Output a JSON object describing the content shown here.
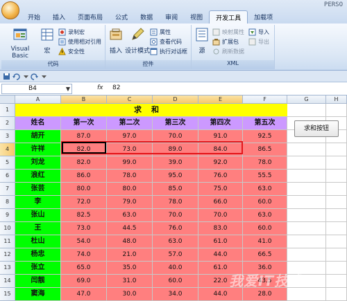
{
  "window": {
    "title_right": "PERSO"
  },
  "ribbon": {
    "tabs": [
      "开始",
      "插入",
      "页面布局",
      "公式",
      "数据",
      "审阅",
      "视图",
      "开发工具",
      "加载项"
    ],
    "active_tab": "开发工具",
    "groups": {
      "code": {
        "label": "代码",
        "visual_basic": "Visual Basic",
        "macros": "宏",
        "record_macro": "录制宏",
        "relative_refs": "使用相对引用",
        "macro_security": "安全性"
      },
      "controls": {
        "label": "控件",
        "insert": "插入",
        "design_mode": "设计模式",
        "properties": "属性",
        "view_code": "查看代码",
        "run_dialog": "执行对话框"
      },
      "xml": {
        "label": "XML",
        "source": "源",
        "map_properties": "映射属性",
        "expansion_packs": "扩展包",
        "refresh_data": "刷新数据",
        "import": "导入",
        "export": "导出"
      }
    }
  },
  "formula_bar": {
    "name_box": "B4",
    "fx": "fx",
    "value": "82"
  },
  "sheet": {
    "columns": [
      "A",
      "B",
      "C",
      "D",
      "E",
      "F",
      "G",
      "H"
    ],
    "rows": [
      "1",
      "2",
      "3",
      "4",
      "5",
      "6",
      "7",
      "8",
      "9",
      "10",
      "11",
      "12",
      "13",
      "14",
      "15",
      "16"
    ],
    "title": "求和",
    "headers": [
      "姓名",
      "第一次",
      "第二次",
      "第三次",
      "第四次",
      "第五次"
    ],
    "records": [
      [
        "胡开",
        "87.0",
        "97.0",
        "70.0",
        "91.0",
        "92.5"
      ],
      [
        "许祥",
        "82.0",
        "73.0",
        "89.0",
        "84.0",
        "86.5"
      ],
      [
        "刘龙",
        "82.0",
        "99.0",
        "39.0",
        "92.0",
        "78.0"
      ],
      [
        "浪红",
        "86.0",
        "78.0",
        "95.0",
        "76.0",
        "55.5"
      ],
      [
        "张芸",
        "80.0",
        "80.0",
        "85.0",
        "75.0",
        "63.0"
      ],
      [
        "李",
        "72.0",
        "79.0",
        "78.0",
        "66.0",
        "60.0"
      ],
      [
        "张山",
        "82.5",
        "63.0",
        "70.0",
        "70.0",
        "63.0"
      ],
      [
        "王",
        "73.0",
        "44.5",
        "76.0",
        "83.0",
        "60.0"
      ],
      [
        "杜山",
        "54.0",
        "48.0",
        "63.0",
        "61.0",
        "41.0"
      ],
      [
        "杨忠",
        "74.0",
        "21.0",
        "57.0",
        "44.0",
        "66.5"
      ],
      [
        "张立",
        "65.0",
        "35.0",
        "40.0",
        "61.0",
        "36.0"
      ],
      [
        "闫靓",
        "69.0",
        "31.0",
        "60.0",
        "22.0",
        "43.5"
      ],
      [
        "窦海",
        "47.0",
        "30.0",
        "34.0",
        "44.0",
        "28.0"
      ],
      [
        "赵",
        "53.0",
        "20.5",
        "42.0",
        "36.0",
        "20.0"
      ]
    ],
    "button_label": "求和按钮",
    "selection_color": "#e3161b"
  },
  "watermark": "我爱IT技术网"
}
